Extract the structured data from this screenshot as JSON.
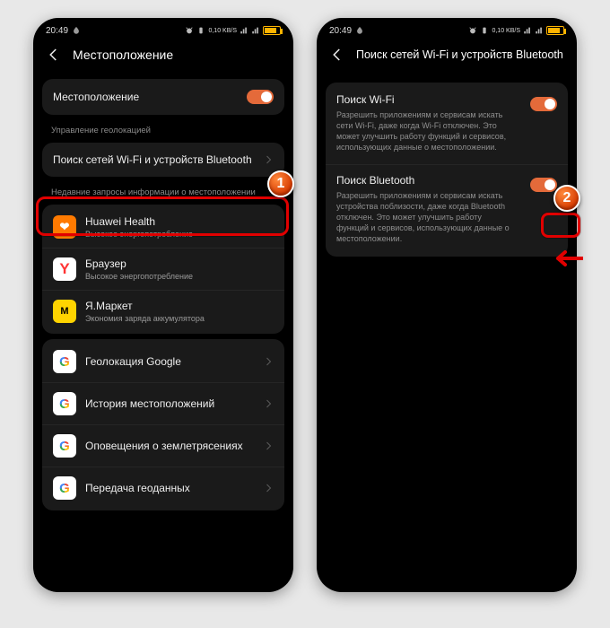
{
  "status": {
    "time": "20:49",
    "net_speed": "0,10 KB/S",
    "indicators": [
      "alarm",
      "vibrate",
      "wifi",
      "signal1",
      "signal2",
      "battery"
    ]
  },
  "screen1": {
    "title": "Местоположение",
    "main_toggle": {
      "label": "Местоположение",
      "on": true
    },
    "section_manage": "Управление геолокацией",
    "scan_row": "Поиск сетей Wi-Fi и устройств Bluetooth",
    "section_recent": "Недавние запросы информации о местоположении",
    "apps": [
      {
        "name": "Huawei Health",
        "sub": "Высокое энергопотребление",
        "icon": "huawei"
      },
      {
        "name": "Браузер",
        "sub": "Высокое энергопотребление",
        "icon": "browser"
      },
      {
        "name": "Я.Маркет",
        "sub": "Экономия заряда аккумулятора",
        "icon": "market"
      }
    ],
    "google_rows": [
      "Геолокация Google",
      "История местоположений",
      "Оповещения о землетрясениях",
      "Передача геоданных"
    ]
  },
  "screen2": {
    "title": "Поиск сетей Wi-Fi и устройств Bluetooth",
    "wifi": {
      "title": "Поиск Wi-Fi",
      "desc": "Разрешить приложениям и сервисам искать сети Wi-Fi, даже когда Wi-Fi отключен. Это может улучшить работу функций и сервисов, использующих данные о местоположении.",
      "on": true
    },
    "bt": {
      "title": "Поиск Bluetooth",
      "desc": "Разрешить приложениям и сервисам искать устройства поблизости, даже когда Bluetooth отключен. Это может улучшить работу функций и сервисов, использующих данные о местоположении.",
      "on": true
    }
  },
  "callouts": {
    "one": "1",
    "two": "2"
  }
}
